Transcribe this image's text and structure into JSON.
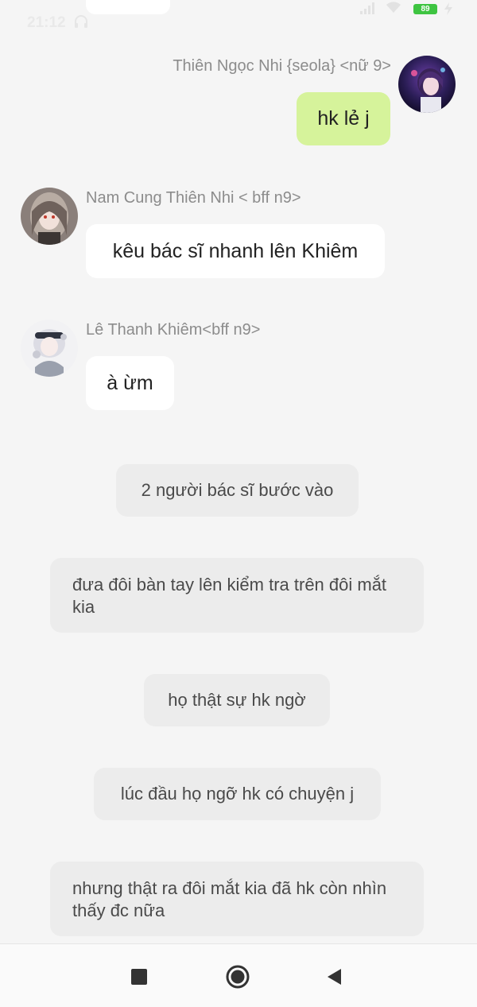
{
  "status_bar": {
    "time": "21:12",
    "battery": "89"
  },
  "messages": [
    {
      "sender": "Thiên Ngọc Nhi {seola} <nữ 9>",
      "text": "hk lẻ j"
    },
    {
      "sender": "Nam Cung Thiên Nhi < bff n9>",
      "text": "kêu bác sĩ nhanh lên Khiêm"
    },
    {
      "sender": "Lê Thanh Khiêm<bff n9>",
      "text": "à ừm"
    }
  ],
  "narrations": [
    "2 người bác sĩ bước vào",
    "đưa đôi bàn tay lên kiểm tra trên đôi mắt kia",
    "họ thật sự hk ngờ",
    "lúc đầu họ ngỡ hk có chuyện j",
    "nhưng thật ra đôi mắt kia đã hk còn nhìn thấy đc nữa"
  ],
  "icons": {
    "headset": "headset-icon",
    "signal": "signal-icon",
    "wifi": "wifi-icon",
    "charging": "charging-icon",
    "nav_recents": "square-icon",
    "nav_home": "circle-icon",
    "nav_back": "triangle-back-icon"
  },
  "colors": {
    "background": "#f5f5f5",
    "own_bubble": "#d6f39b",
    "other_bubble": "#ffffff",
    "narration_bubble": "#ececec",
    "battery": "#3ec441"
  }
}
